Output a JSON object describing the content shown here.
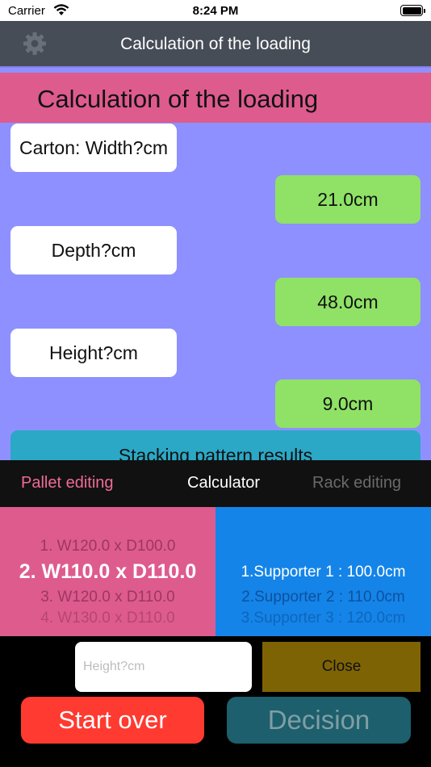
{
  "status_bar": {
    "carrier": "Carrier",
    "time": "8:24 PM"
  },
  "nav": {
    "title": "Calculation of the loading",
    "settings_icon": "gear-icon"
  },
  "banner": {
    "title": "Calculation of the loading"
  },
  "fields": [
    {
      "label": "Carton: Width?cm",
      "value": "21.0cm"
    },
    {
      "label": "Depth?cm",
      "value": "48.0cm"
    },
    {
      "label": "Height?cm",
      "value": "9.0cm"
    }
  ],
  "results_button": "Stacking pattern results",
  "tabs": [
    {
      "label": "Pallet editing",
      "color": "#f06a98"
    },
    {
      "label": "Calculator",
      "color": "#ffffff"
    },
    {
      "label": "Rack editing",
      "color": "#6a6a6a"
    }
  ],
  "pallet_picker": {
    "items": [
      "1. W120.0 x D100.0",
      "2. W110.0 x D110.0",
      "3. W120.0 x D110.0",
      "4. W130.0 x D110.0"
    ],
    "selected": "2. W110.0 x D110.0",
    "color": "#de5b8e"
  },
  "rack_picker": {
    "items": [
      "1.Supporter 1 : 100.0cm",
      "2.Supporter 2 : 110.0cm",
      "3.Supporter 3 : 120.0cm"
    ],
    "selected": "1.Supporter 1 : 100.0cm",
    "color": "#1484e8"
  },
  "height_input": {
    "placeholder": "Height?cm",
    "value": ""
  },
  "close_button": "Close",
  "start_over_button": "Start over",
  "decision_button": "Decision",
  "colors": {
    "content_bg": "#8f90ff",
    "banner": "#de5b8e",
    "value_box": "#8fe265",
    "results_button": "#2ba8c6",
    "close_button": "#7e6305",
    "start_over": "#ff3a30",
    "decision": "#1d5f6c"
  }
}
